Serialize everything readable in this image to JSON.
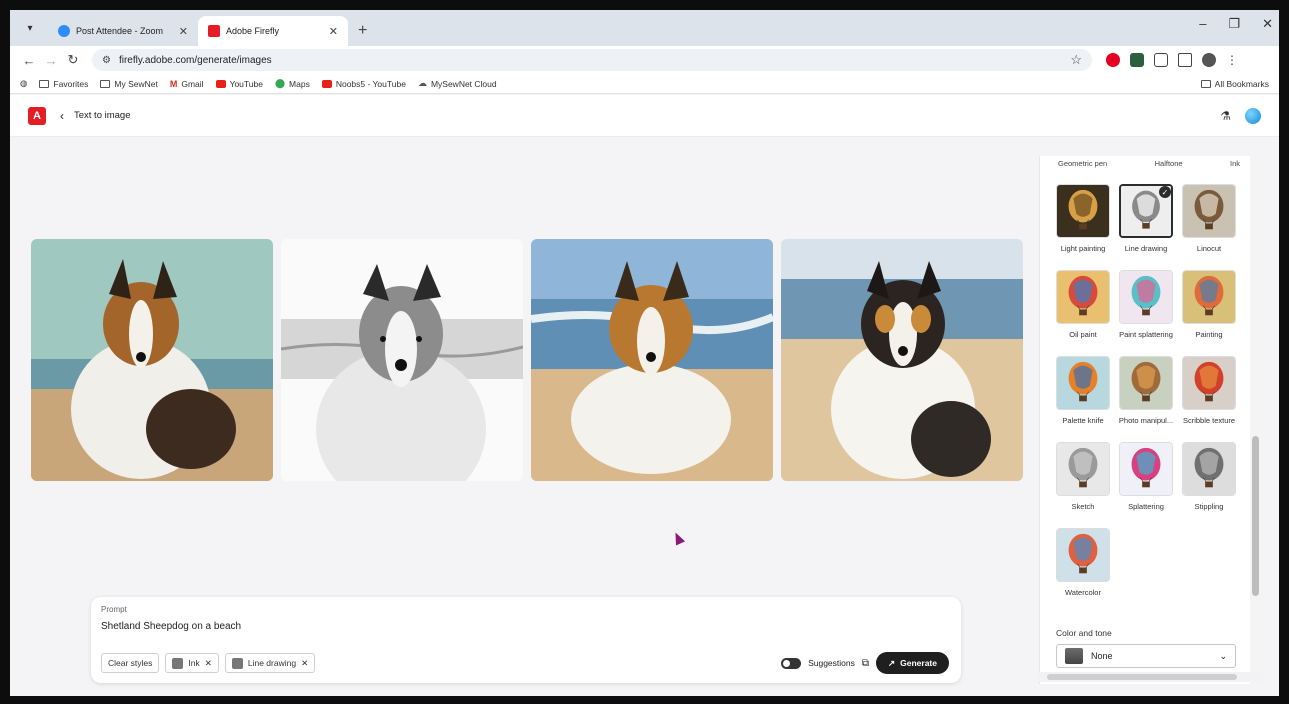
{
  "browser": {
    "tabs": [
      {
        "title": "Post Attendee - Zoom",
        "favicon_color": "#2d8cff"
      },
      {
        "title": "Adobe Firefly",
        "favicon_color": "#e41e26"
      }
    ],
    "url": "firefly.adobe.com/generate/images",
    "bookmarks": [
      "Favorites",
      "My SewNet",
      "Gmail",
      "YouTube",
      "Maps",
      "Noobs5 - YouTube",
      "MySewNet Cloud"
    ],
    "all_bookmarks": "All Bookmarks"
  },
  "app": {
    "breadcrumb": "Text to image"
  },
  "prompt": {
    "label": "Prompt",
    "text": "Shetland Sheepdog on a beach",
    "clear_label": "Clear styles",
    "chips": [
      "Ink",
      "Line drawing"
    ],
    "suggestions_label": "Suggestions",
    "generate_label": "Generate"
  },
  "styles_panel": {
    "top_row": [
      "Geometric pen",
      "Halftone",
      "Ink"
    ],
    "styles": [
      {
        "label": "Light painting",
        "selected": false
      },
      {
        "label": "Line drawing",
        "selected": true
      },
      {
        "label": "Linocut",
        "selected": false
      },
      {
        "label": "Oil paint",
        "selected": false
      },
      {
        "label": "Paint splattering",
        "selected": false
      },
      {
        "label": "Painting",
        "selected": false
      },
      {
        "label": "Palette knife",
        "selected": false
      },
      {
        "label": "Photo manipul...",
        "selected": false
      },
      {
        "label": "Scribble texture",
        "selected": false
      },
      {
        "label": "Sketch",
        "selected": false
      },
      {
        "label": "Splattering",
        "selected": false
      },
      {
        "label": "Stippling",
        "selected": false
      },
      {
        "label": "Watercolor",
        "selected": false
      }
    ],
    "color_tone_label": "Color and tone",
    "color_tone_value": "None"
  }
}
